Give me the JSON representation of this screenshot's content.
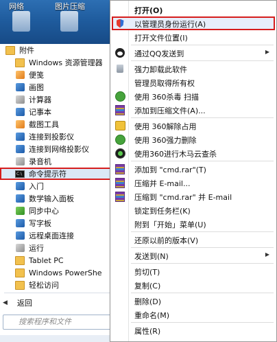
{
  "desktop": {
    "icons": [
      {
        "label": "网络",
        "icon": "network-icon"
      },
      {
        "label": "图片压缩",
        "icon": "image-compress-icon"
      }
    ]
  },
  "start_menu": {
    "programs": [
      {
        "label": "附件",
        "icon": "folder-icon",
        "level": 1
      },
      {
        "label": "Windows 资源管理器",
        "icon": "explorer-icon",
        "level": 2
      },
      {
        "label": "便笺",
        "icon": "sticky-notes-icon",
        "level": 2
      },
      {
        "label": "画图",
        "icon": "paint-icon",
        "level": 2
      },
      {
        "label": "计算器",
        "icon": "calculator-icon",
        "level": 2
      },
      {
        "label": "记事本",
        "icon": "notepad-icon",
        "level": 2
      },
      {
        "label": "截图工具",
        "icon": "snipping-tool-icon",
        "level": 2
      },
      {
        "label": "连接到投影仪",
        "icon": "projector-icon",
        "level": 2
      },
      {
        "label": "连接到网络投影仪",
        "icon": "network-projector-icon",
        "level": 2
      },
      {
        "label": "录音机",
        "icon": "sound-recorder-icon",
        "level": 2
      },
      {
        "label": "命令提示符",
        "icon": "cmd-icon",
        "level": 2,
        "selected": true
      },
      {
        "label": "入门",
        "icon": "getting-started-icon",
        "level": 2
      },
      {
        "label": "数学输入面板",
        "icon": "math-input-icon",
        "level": 2
      },
      {
        "label": "同步中心",
        "icon": "sync-center-icon",
        "level": 2
      },
      {
        "label": "写字板",
        "icon": "wordpad-icon",
        "level": 2
      },
      {
        "label": "远程桌面连接",
        "icon": "remote-desktop-icon",
        "level": 2
      },
      {
        "label": "运行",
        "icon": "run-icon",
        "level": 2
      },
      {
        "label": "Tablet PC",
        "icon": "folder-icon",
        "level": 2
      },
      {
        "label": "Windows PowerShe",
        "icon": "folder-icon",
        "level": 2
      },
      {
        "label": "轻松访问",
        "icon": "folder-icon",
        "level": 2
      }
    ],
    "back_label": "返回",
    "search_placeholder": "搜索程序和文件"
  },
  "context_menu": {
    "items": [
      {
        "label": "打开(O)",
        "icon": "",
        "bold": true,
        "sep_after": false
      },
      {
        "label": "以管理员身份运行(A)",
        "icon": "uac-shield-icon",
        "highlight": true,
        "sep_after": false
      },
      {
        "label": "打开文件位置(I)",
        "icon": "",
        "sep_after": true
      },
      {
        "label": "通过QQ发送到",
        "icon": "qq-icon",
        "submenu": true,
        "sep_after": true
      },
      {
        "label": "强力卸载此软件",
        "icon": "uninstall-icon",
        "sep_after": false
      },
      {
        "label": "管理员取得所有权",
        "icon": "",
        "sep_after": false
      },
      {
        "label": "使用 360杀毒 扫描",
        "icon": "360-antivirus-icon",
        "sep_after": false
      },
      {
        "label": "添加到压缩文件(A)...",
        "icon": "winrar-icon",
        "sep_after": true
      },
      {
        "label": "使用 360解除占用",
        "icon": "360-unlock-icon",
        "sep_after": false
      },
      {
        "label": "使用 360强力删除",
        "icon": "360-force-delete-icon",
        "sep_after": false
      },
      {
        "label": "使用360进行木马云查杀",
        "icon": "360-trojan-scan-icon",
        "sep_after": true
      },
      {
        "label": "添加到 \"cmd.rar\"(T)",
        "icon": "winrar-icon",
        "sep_after": false
      },
      {
        "label": "压缩并 E-mail...",
        "icon": "winrar-icon",
        "sep_after": false
      },
      {
        "label": "压缩到 \"cmd.rar\" 并 E-mail",
        "icon": "winrar-icon",
        "sep_after": false
      },
      {
        "label": "锁定到任务栏(K)",
        "icon": "",
        "sep_after": false
      },
      {
        "label": "附到「开始」菜单(U)",
        "icon": "",
        "sep_after": true
      },
      {
        "label": "还原以前的版本(V)",
        "icon": "",
        "sep_after": true
      },
      {
        "label": "发送到(N)",
        "icon": "",
        "submenu": true,
        "sep_after": true
      },
      {
        "label": "剪切(T)",
        "icon": "",
        "sep_after": false
      },
      {
        "label": "复制(C)",
        "icon": "",
        "sep_after": true
      },
      {
        "label": "删除(D)",
        "icon": "",
        "sep_after": false
      },
      {
        "label": "重命名(M)",
        "icon": "",
        "sep_after": true
      },
      {
        "label": "属性(R)",
        "icon": "",
        "sep_after": false
      }
    ]
  }
}
